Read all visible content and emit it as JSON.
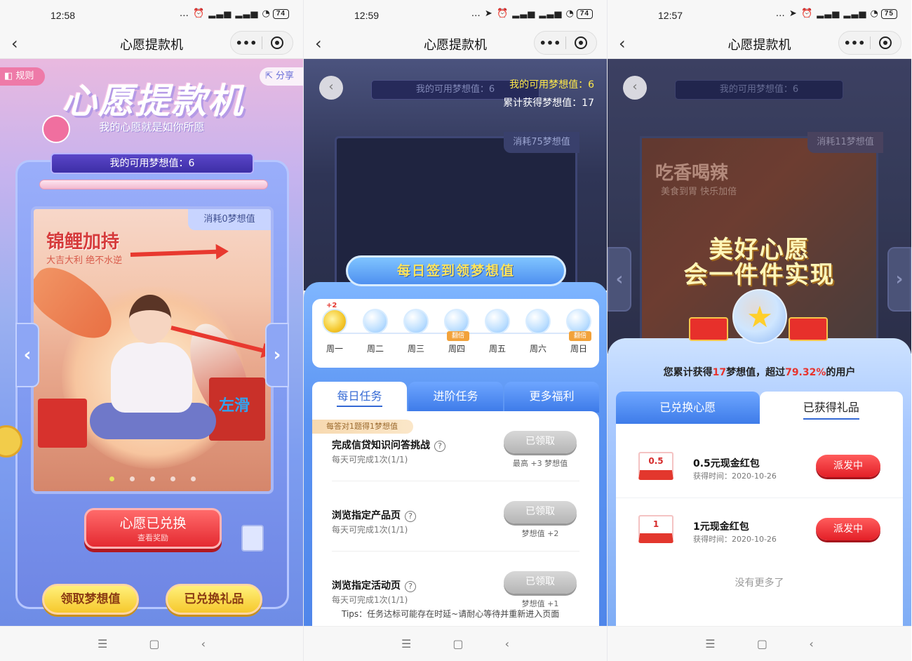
{
  "status_bars": [
    {
      "time": "12:58",
      "battery": "74"
    },
    {
      "time": "12:59",
      "battery": "74"
    },
    {
      "time": "12:57",
      "battery": "75"
    }
  ],
  "status_icons": "… ⏰ ▂▃▅ ▂▃▅ ◔",
  "status_icons_loc": "… ➤ ⏰ ▂▃▅ ▂▃▅ ◔",
  "nav": {
    "title": "心愿提款机",
    "back": "‹",
    "more": "•••"
  },
  "sys_nav": {
    "menu": "☰",
    "home": "▢",
    "back": "‹"
  },
  "phone1": {
    "rule": "规则",
    "share": "分享",
    "logo": "心愿提款机",
    "slogan": "我的心愿就是如你所愿",
    "dream_bar": "我的可用梦想值：6",
    "cost": "消耗0梦想值",
    "banner_title": "锦鲤加持",
    "banner_sub": "大吉大利 绝不水逆",
    "slide_hint": "左滑",
    "exchange_main": "心愿已兑换",
    "exchange_sub": "查看奖励",
    "btn_get": "领取梦想值",
    "btn_gifts": "已兑换礼品",
    "prev": "‹",
    "next": "›"
  },
  "phone2": {
    "dream_bar": "我的可用梦想值：6",
    "available": "我的可用梦想值：6",
    "total": "累计获得梦想值：17",
    "cost": "消耗75梦想值",
    "sign_title": "每日签到领梦想值",
    "first_plus": "+2",
    "double_tag": "翻倍",
    "days": [
      "周一",
      "周二",
      "周三",
      "周四",
      "周五",
      "周六",
      "周日"
    ],
    "tabs": [
      "每日任务",
      "进阶任务",
      "更多福利"
    ],
    "badge": "每答对1题得1梦想值",
    "tasks": [
      {
        "name": "完成信贷知识问答挑战",
        "sub": "每天可完成1次(1/1)",
        "btn": "已领取",
        "reward": "最高 +3 梦想值"
      },
      {
        "name": "浏览指定产品页",
        "sub": "每天可完成1次(1/1)",
        "btn": "已领取",
        "reward": "梦想值 +2"
      },
      {
        "name": "浏览指定活动页",
        "sub": "每天可完成1次(1/1)",
        "btn": "已领取",
        "reward": "梦想值 +1"
      }
    ],
    "tips": "Tips：任务达标可能存在时延~请耐心等待并重新进入页面"
  },
  "phone3": {
    "dream_bar": "我的可用梦想值：6",
    "cost": "消耗11梦想值",
    "food_title": "吃香喝辣",
    "food_sub": "美食到胃 快乐加倍",
    "wish_line1": "美好心愿",
    "wish_line2": "会一件件实现",
    "summary_pre": "您累计获得",
    "summary_num": "17",
    "summary_mid": "梦想值，超过",
    "summary_pct": "79.32%",
    "summary_post": "的用户",
    "tabs": [
      "已兑换心愿",
      "已获得礼品"
    ],
    "gifts": [
      {
        "env": "0.5",
        "name": "0.5元现金红包",
        "time": "获得时间：2020-10-26",
        "btn": "派发中"
      },
      {
        "env": "1",
        "name": "1元现金红包",
        "time": "获得时间：2020-10-26",
        "btn": "派发中"
      }
    ],
    "no_more": "没有更多了"
  }
}
